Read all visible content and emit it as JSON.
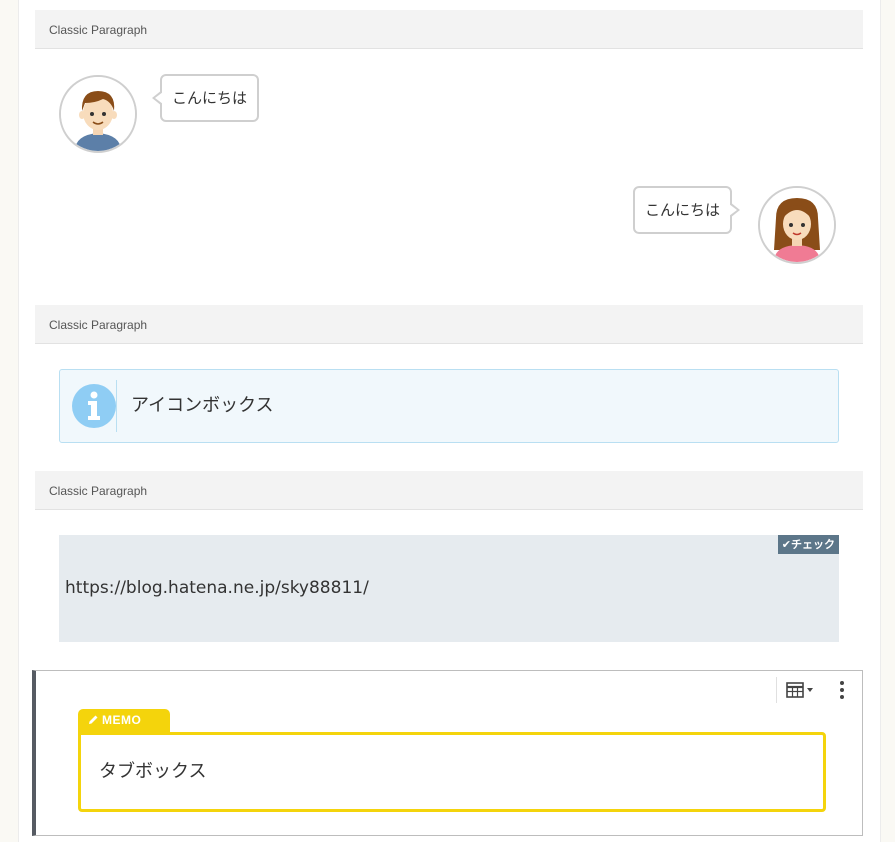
{
  "blocks": [
    {
      "header": "Classic Paragraph"
    },
    {
      "header": "Classic Paragraph"
    },
    {
      "header": "Classic Paragraph"
    }
  ],
  "speech": {
    "left": {
      "text": "こんにちは",
      "avatar": "boy-avatar"
    },
    "right": {
      "text": "こんにちは",
      "avatar": "girl-avatar"
    }
  },
  "icon_box": {
    "icon": "info-icon",
    "text": "アイコンボックス",
    "accent": "#5bb5ea"
  },
  "check_box": {
    "label": "チェック",
    "url": "https://blog.hatena.ne.jp/sky88811/",
    "label_color": "#5c7689"
  },
  "tab_box": {
    "tab_label": "MEMO",
    "text": "タブボックス",
    "accent": "#f4d40c"
  },
  "toolbar": {
    "icons": [
      "table-icon",
      "chevron-down-icon",
      "more-vertical-icon"
    ]
  }
}
